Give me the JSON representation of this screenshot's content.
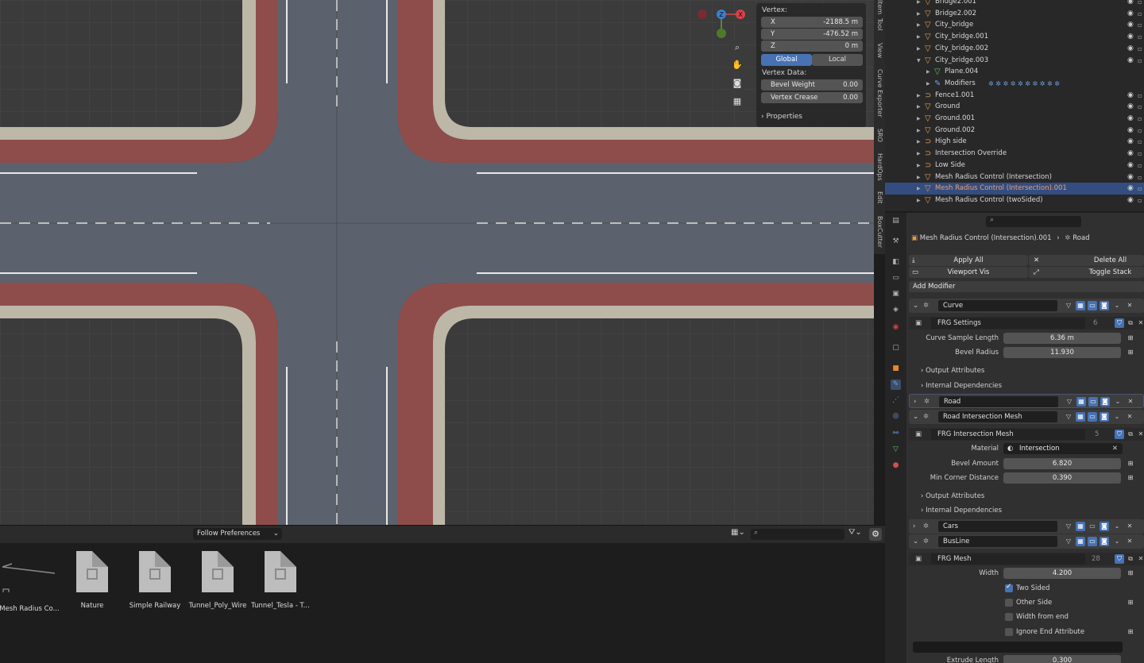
{
  "viewport": {
    "vertex_label": "Vertex:",
    "x_label": "X",
    "x_value": "-2188.5 m",
    "y_label": "Y",
    "y_value": "-476.52 m",
    "z_label": "Z",
    "z_value": "0 m",
    "global_label": "Global",
    "local_label": "Local",
    "vertex_data_label": "Vertex Data:",
    "bevel_weight_label": "Bevel Weight",
    "bevel_weight_value": "0.00",
    "vertex_crease_label": "Vertex Crease",
    "vertex_crease_value": "0.00",
    "properties_label": "Properties",
    "gizmo_z": "Z",
    "gizmo_x": "X"
  },
  "side_tabs": [
    "Item",
    "Tool",
    "View",
    "Curve Exporter",
    "SRO",
    "HardOps",
    "Edit",
    "BoxCutter"
  ],
  "outliner": {
    "rows": [
      {
        "label": "Bridge2.001",
        "icon": "mesh"
      },
      {
        "label": "Bridge2.002",
        "icon": "mesh"
      },
      {
        "label": "City_bridge",
        "icon": "mesh"
      },
      {
        "label": "City_bridge.001",
        "icon": "mesh"
      },
      {
        "label": "City_bridge.002",
        "icon": "mesh"
      },
      {
        "label": "City_bridge.003",
        "icon": "mesh",
        "expanded": true
      },
      {
        "label": "Plane.004",
        "icon": "data"
      },
      {
        "label": "Modifiers",
        "icon": "wrench"
      },
      {
        "label": "Fence1.001",
        "icon": "curve"
      },
      {
        "label": "Ground",
        "icon": "mesh"
      },
      {
        "label": "Ground.001",
        "icon": "mesh"
      },
      {
        "label": "Ground.002",
        "icon": "mesh"
      },
      {
        "label": "High side",
        "icon": "curve"
      },
      {
        "label": "Intersection Override",
        "icon": "curve"
      },
      {
        "label": "Low Side",
        "icon": "curve"
      },
      {
        "label": "Mesh Radius Control (Intersection)",
        "icon": "mesh"
      },
      {
        "label": "Mesh Radius Control (Intersection).001",
        "icon": "mesh",
        "selected": true
      },
      {
        "label": "Mesh Radius Control (twoSided)",
        "icon": "mesh"
      }
    ]
  },
  "properties": {
    "breadcrumb_object": "Mesh Radius Control (Intersection).001",
    "breadcrumb_modifier": "Road",
    "apply_all": "Apply All",
    "delete_all": "Delete All",
    "viewport_vis": "Viewport Vis",
    "toggle_stack": "Toggle Stack",
    "add_modifier": "Add Modifier",
    "curve_mod": {
      "name": "Curve",
      "group": "FRG Settings",
      "group_users": "6",
      "curve_sample_length_label": "Curve Sample Length",
      "curve_sample_length": "6.36 m",
      "bevel_radius_label": "Bevel Radius",
      "bevel_radius": "11.930",
      "output_attributes": "Output Attributes",
      "internal_dependencies": "Internal Dependencies"
    },
    "road_mod": {
      "name": "Road"
    },
    "intersection_mod": {
      "name": "Road Intersection Mesh",
      "group": "FRG Intersection Mesh",
      "group_users": "5",
      "material_label": "Material",
      "material": "Intersection",
      "bevel_amount_label": "Bevel Amount",
      "bevel_amount": "6.820",
      "min_corner_label": "Min Corner Distance",
      "min_corner": "0.390",
      "output_attributes": "Output Attributes",
      "internal_dependencies": "Internal Dependencies"
    },
    "cars_mod": {
      "name": "Cars"
    },
    "busline_mod": {
      "name": "BusLine",
      "group": "FRG Mesh",
      "group_users": "28",
      "width_label": "Width",
      "width": "4.200",
      "two_sided": "Two Sided",
      "other_side": "Other Side",
      "width_from_end": "Width from end",
      "ignore_end": "Ignore End Attribute",
      "extrude_label": "Extrude Length",
      "extrude": "0.300"
    }
  },
  "file_browser": {
    "dropdown": "Follow Preferences",
    "assets": [
      "Mesh Radius Co...",
      "Nature",
      "Simple Railway",
      "Tunnel_Poly_Wire",
      "Tunnel_Tesla - T..."
    ]
  },
  "colors": {
    "accent": "#4772b3",
    "selected_row": "#334d80",
    "road": "#5c626d",
    "bike_lane": "#8e4d4b",
    "curb": "#bdb7a8"
  }
}
